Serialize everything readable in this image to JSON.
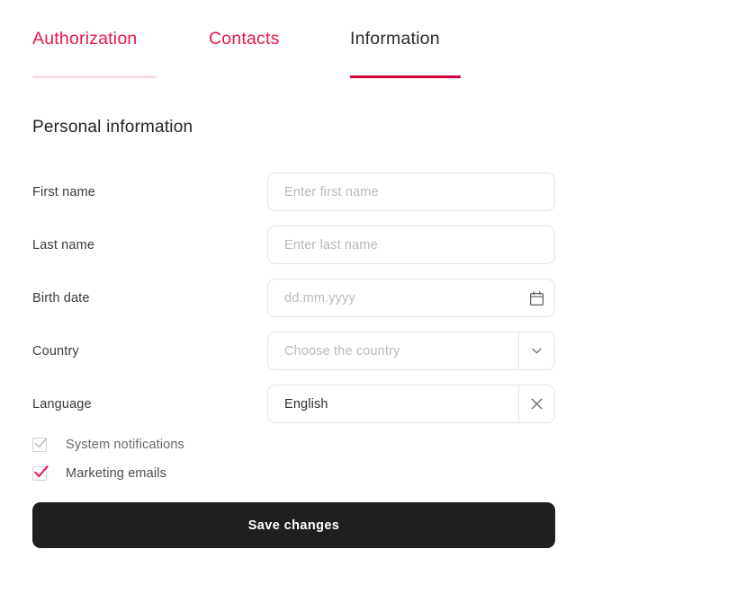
{
  "theme": {
    "accent": "#e8174a",
    "accent_active_underline": "#d0043c",
    "accent_visited_underline": "#fbdde5",
    "button_bg": "#1f1f1f",
    "border": "#e4e4e6",
    "placeholder": "#b9b9bd",
    "label": "#3a3a3a",
    "disabled_check": "#b5b5ba"
  },
  "tabs": [
    {
      "label": "Authorization",
      "state": "visited",
      "active": false
    },
    {
      "label": "Contacts",
      "state": "default",
      "active": false
    },
    {
      "label": "Information",
      "state": "active",
      "active": true
    }
  ],
  "section": {
    "title": "Personal information"
  },
  "fields": {
    "first_name": {
      "label": "First name",
      "placeholder": "Enter first name",
      "value": ""
    },
    "last_name": {
      "label": "Last name",
      "placeholder": "Enter last name",
      "value": ""
    },
    "birth_date": {
      "label": "Birth date",
      "placeholder": "dd.mm.yyyy",
      "value": "",
      "icon": "calendar-icon"
    },
    "country": {
      "label": "Country",
      "placeholder": "Choose the country",
      "value": "",
      "icon": "chevron-down-icon"
    },
    "language": {
      "label": "Language",
      "placeholder": "",
      "value": "English",
      "icon": "close-icon"
    }
  },
  "checkboxes": [
    {
      "label": "System notifications",
      "checked": true,
      "disabled": true
    },
    {
      "label": "Marketing emails",
      "checked": true,
      "disabled": false
    }
  ],
  "actions": {
    "save_label": "Save changes"
  }
}
